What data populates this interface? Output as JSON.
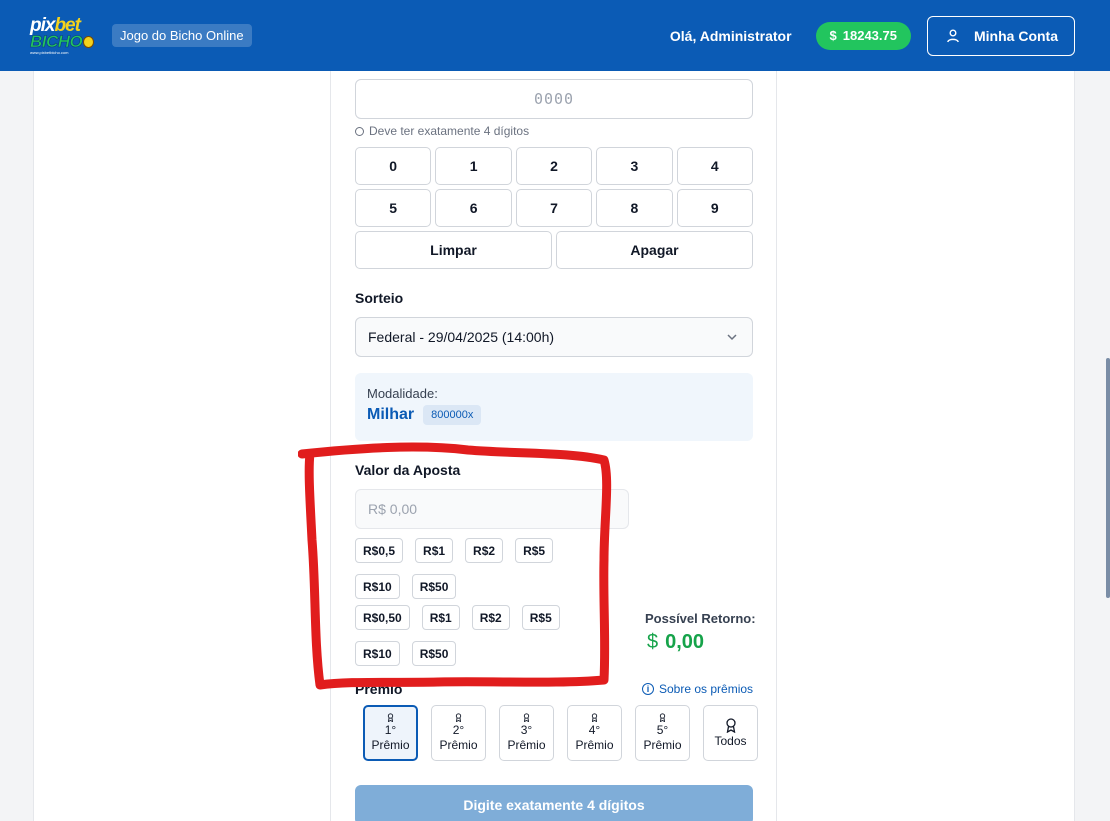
{
  "header": {
    "logo": {
      "top_a": "pix",
      "top_b": "bet",
      "bottom": "BICHO",
      "url": "www.pixbetbicho.com"
    },
    "site_badge": "Jogo do Bicho Online",
    "greeting": "Olá, Administrator",
    "balance_currency": "$",
    "balance": "18243.75",
    "account_label": "Minha Conta"
  },
  "number_input": {
    "placeholder": "0000",
    "hint": "Deve ter exatamente 4 dígitos"
  },
  "keypad": {
    "digits": [
      "0",
      "1",
      "2",
      "3",
      "4",
      "5",
      "6",
      "7",
      "8",
      "9"
    ],
    "clear": "Limpar",
    "backspace": "Apagar"
  },
  "sorteio": {
    "label": "Sorteio",
    "selected": "Federal - 29/04/2025 (14:00h)"
  },
  "modalidade": {
    "label": "Modalidade:",
    "name": "Milhar",
    "multiplier": "800000x"
  },
  "aposta": {
    "label": "Valor da Aposta",
    "placeholder": "R$ 0,00",
    "quick_values_a": [
      "R$0,5",
      "R$1",
      "R$2",
      "R$5",
      "R$10",
      "R$50"
    ],
    "quick_values_b": [
      "R$0,50",
      "R$1",
      "R$2",
      "R$5",
      "R$10",
      "R$50"
    ]
  },
  "retorno": {
    "label": "Possível Retorno:",
    "currency": "$",
    "value": "0,00"
  },
  "premio": {
    "label": "Prêmio",
    "about": "Sobre os prêmios",
    "options": [
      {
        "num": "1°",
        "text": "Prêmio",
        "active": true
      },
      {
        "num": "2°",
        "text": "Prêmio",
        "active": false
      },
      {
        "num": "3°",
        "text": "Prêmio",
        "active": false
      },
      {
        "num": "4°",
        "text": "Prêmio",
        "active": false
      },
      {
        "num": "5°",
        "text": "Prêmio",
        "active": false
      }
    ],
    "all": "Todos"
  },
  "submit_label": "Digite exatamente 4 dígitos",
  "colors": {
    "brand": "#0b5bb5",
    "success": "#22c55e",
    "annotation": "#e11d1d"
  }
}
